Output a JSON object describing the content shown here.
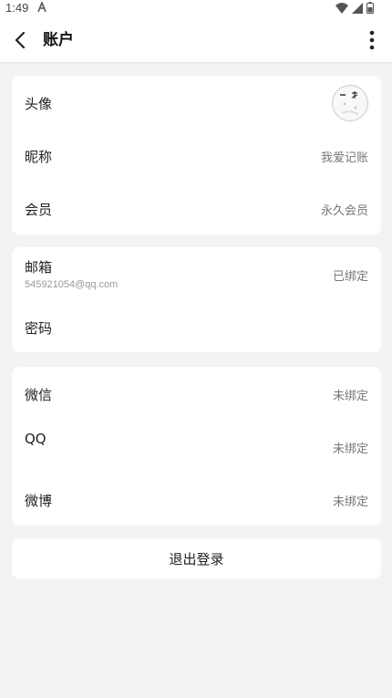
{
  "status_bar": {
    "time": "1:49"
  },
  "app_bar": {
    "title": "账户"
  },
  "profile": {
    "avatar_label": "头像",
    "nickname_label": "昵称",
    "nickname_value": "我爱记账",
    "member_label": "会员",
    "member_value": "永久会员"
  },
  "account": {
    "email_label": "邮箱",
    "email_value": "545921054@qq.com",
    "email_status": "已绑定",
    "password_label": "密码"
  },
  "social": {
    "wechat_label": "微信",
    "wechat_status": "未绑定",
    "qq_label": "QQ",
    "qq_status": "未绑定",
    "weibo_label": "微博",
    "weibo_status": "未绑定"
  },
  "logout": {
    "label": "退出登录"
  }
}
